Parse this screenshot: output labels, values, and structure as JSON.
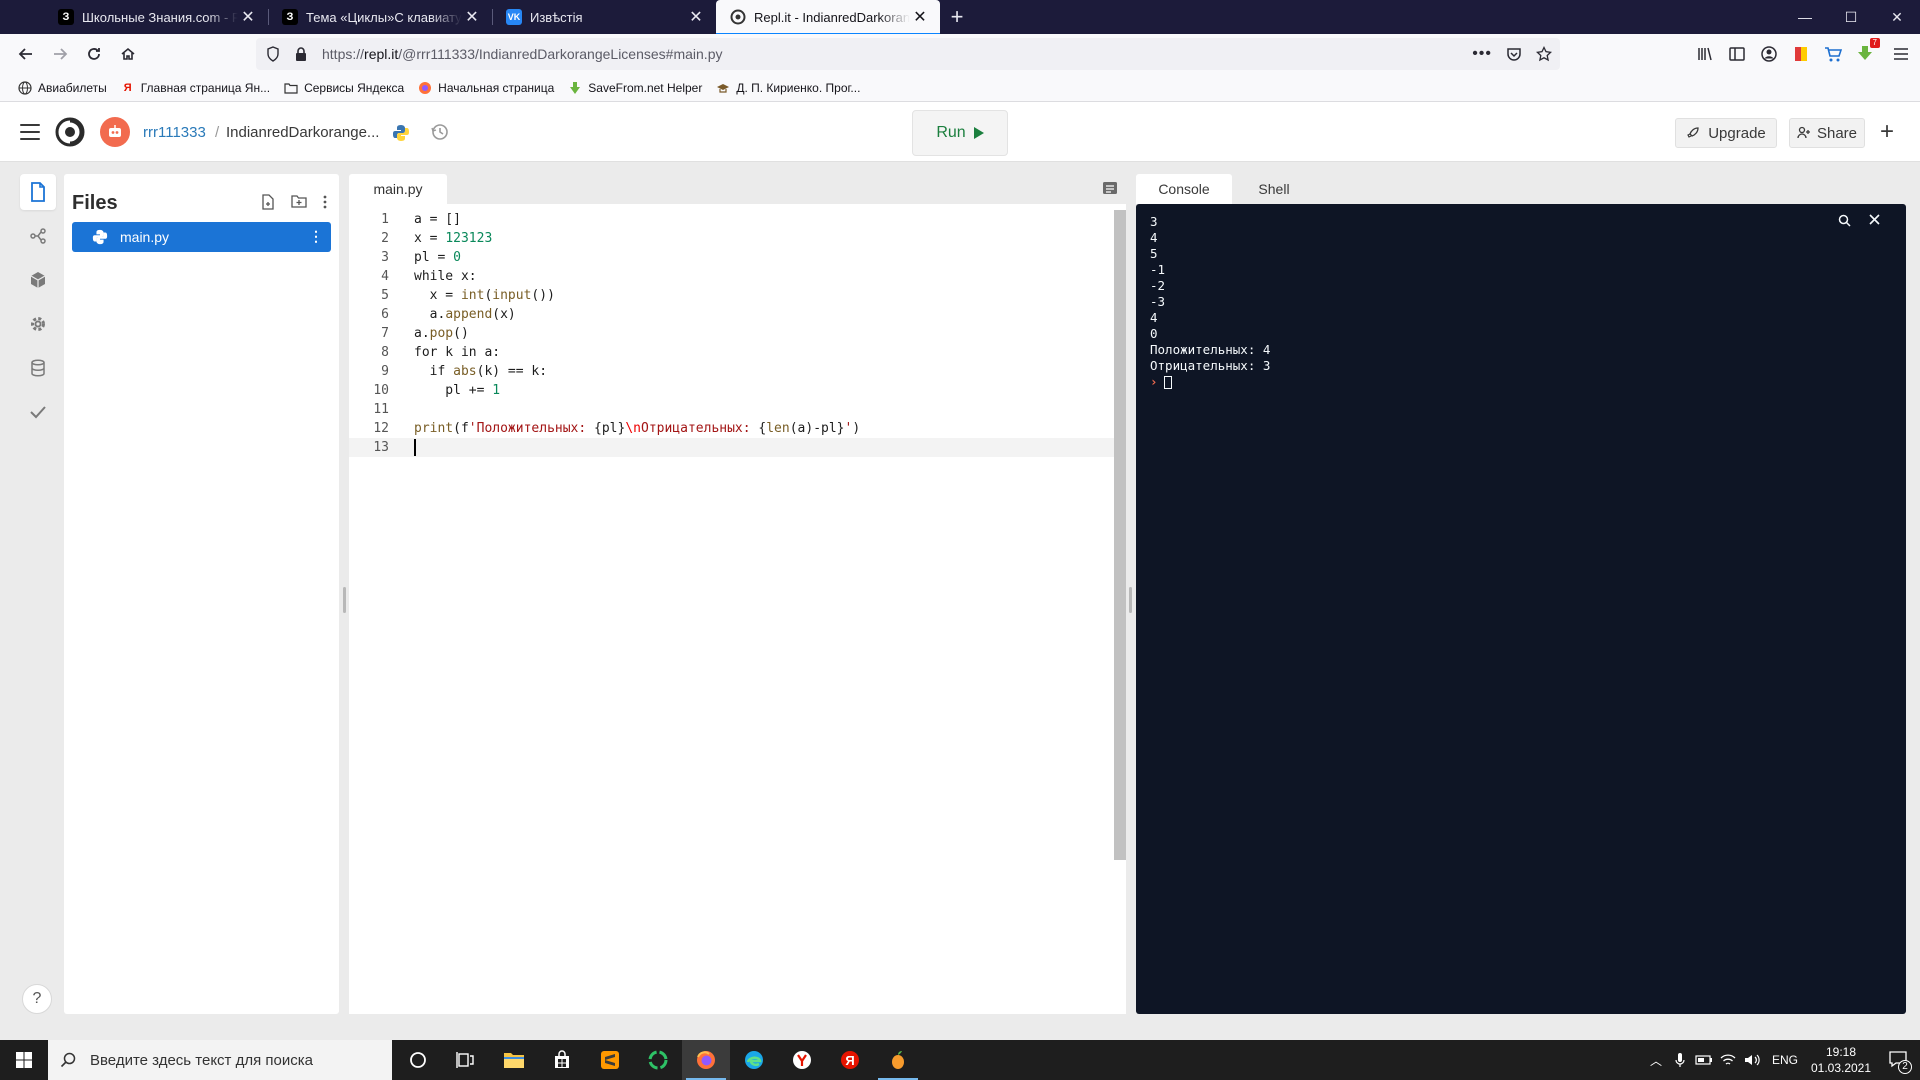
{
  "browser": {
    "tabs": [
      {
        "title": "Школьные Знания.com - Реш",
        "favicon": "znanija-icon"
      },
      {
        "title": "Тема «Циклы»С клавиатуры в",
        "favicon": "znanija-icon"
      },
      {
        "title": "Извѣстія",
        "favicon": "vk-icon"
      },
      {
        "title": "Repl.it - IndianredDarkorangeL",
        "favicon": "replit-icon"
      }
    ],
    "url_prefix": "https://",
    "url_host": "repl.it",
    "url_path": "/@rrr111333/IndianredDarkorangeLicenses#main.py",
    "bookmarks": [
      "Авиабилеты",
      "Главная страница Ян...",
      "Сервисы Яндекса",
      "Начальная страница",
      "SaveFrom.net Helper",
      "Д. П. Кириенко. Прог..."
    ],
    "notification_badge": "7"
  },
  "replit": {
    "username": "rrr111333",
    "separator": "/",
    "repl_name": "IndianredDarkorange...",
    "run_label": "Run",
    "upgrade_label": "Upgrade",
    "share_label": "Share",
    "files_title": "Files",
    "file_name": "main.py",
    "editor_tab": "main.py",
    "console_tab": "Console",
    "shell_tab": "Shell",
    "help": "?"
  },
  "code_lines": [
    "1",
    "2",
    "3",
    "4",
    "5",
    "6",
    "7",
    "8",
    "9",
    "10",
    "11",
    "12",
    "13"
  ],
  "console_output": [
    "3",
    "4",
    "5",
    "-1",
    "-2",
    "-3",
    "4",
    "0",
    "Положительных: 4",
    "Отрицательных: 3"
  ],
  "taskbar": {
    "search_placeholder": "Введите здесь текст для поиска",
    "lang": "ENG",
    "time": "19:18",
    "date": "01.03.2021",
    "notif_count": "2"
  },
  "colors": {
    "tabstrip": "#1c1b3a",
    "accent_blue": "#1b74d6",
    "run_green": "#1b7f3e",
    "console_bg": "#0e1525",
    "prompt": "#f26b4f"
  }
}
